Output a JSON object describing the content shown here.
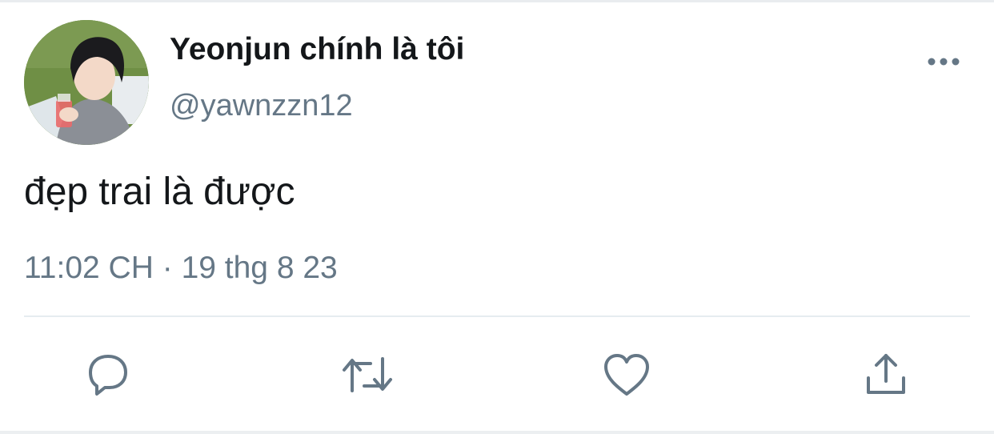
{
  "tweet": {
    "display_name": "Yeonjun chính là tôi",
    "handle": "@yawnzzn12",
    "text": "đẹp trai là được",
    "time": "11:02 CH",
    "separator": "·",
    "date": "19 thg 8 23"
  },
  "icons": {
    "more": "more-horizontal-icon",
    "reply": "reply-icon",
    "retweet": "retweet-icon",
    "like": "heart-icon",
    "share": "share-icon"
  },
  "colors": {
    "text_primary": "#14171a",
    "text_secondary": "#657786",
    "icon": "#657786",
    "divider": "#e6ecf0"
  }
}
